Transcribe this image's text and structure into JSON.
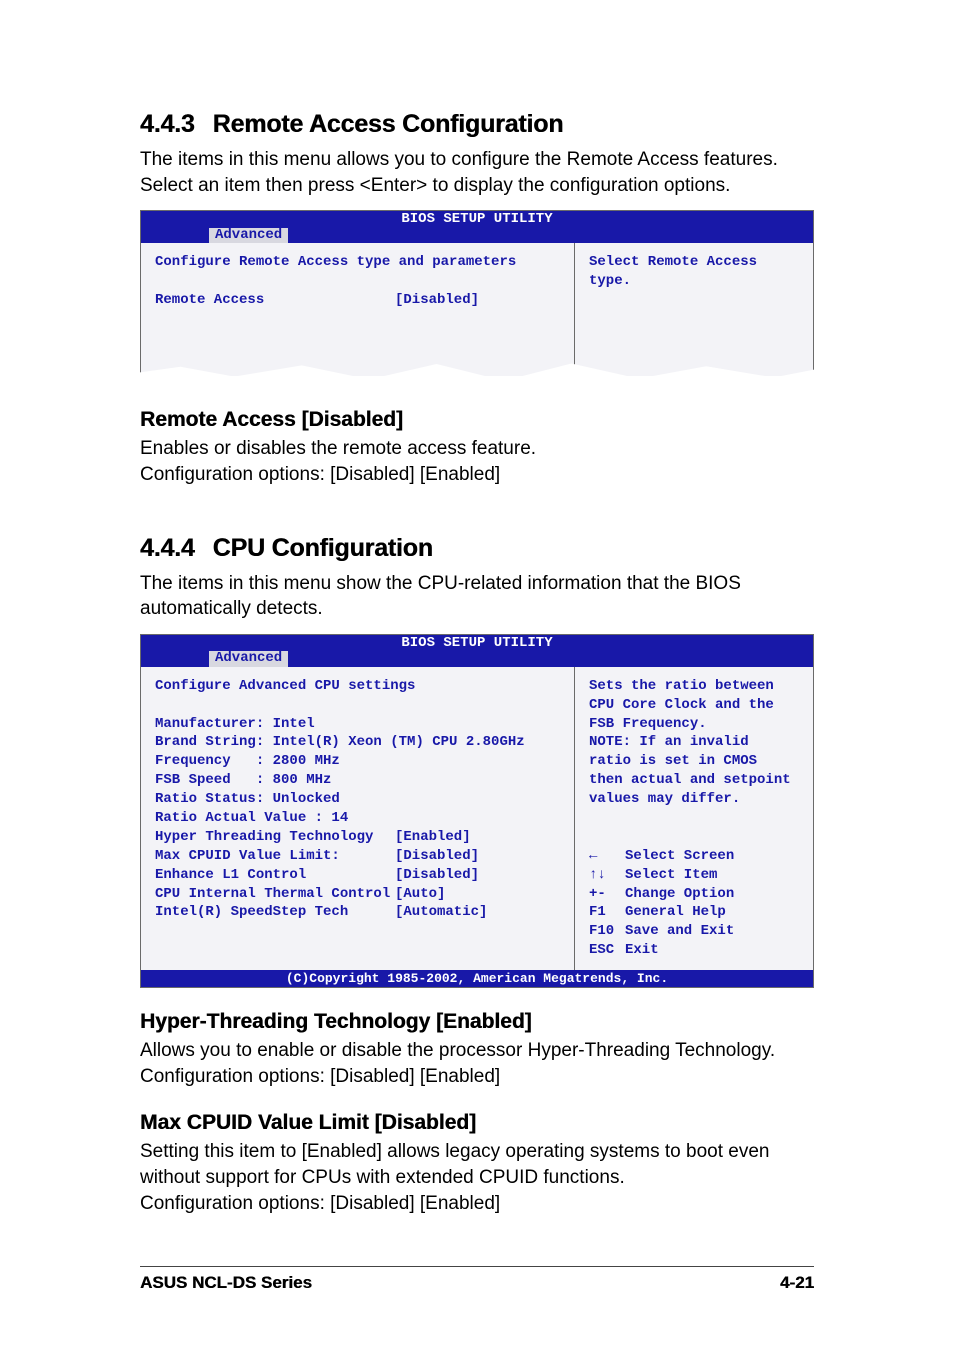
{
  "section443": {
    "number": "4.4.3",
    "title": "Remote Access Configuration",
    "intro": "The items in this menu allows you to configure the Remote Access features. Select an item then press <Enter> to display the configuration options."
  },
  "bios_ra": {
    "title": "BIOS SETUP UTILITY",
    "tab": "Advanced",
    "heading": "Configure Remote Access type and parameters",
    "item_label": "Remote Access",
    "item_value": "[Disabled]",
    "help": "Select Remote Access type."
  },
  "remote_access": {
    "heading": "Remote Access [Disabled]",
    "desc1": "Enables or disables the remote access feature.",
    "desc2": "Configuration options: [Disabled] [Enabled]"
  },
  "section444": {
    "number": "4.4.4",
    "title": "CPU Configuration",
    "intro": "The items in this menu show the CPU-related information that the BIOS automatically detects."
  },
  "bios_cpu": {
    "title": "BIOS SETUP UTILITY",
    "tab": "Advanced",
    "heading": "Configure Advanced CPU settings",
    "manufacturer": "Manufacturer: Intel",
    "brand": "Brand String: Intel(R) Xeon (TM) CPU 2.80GHz",
    "frequency": "Frequency   : 2800 MHz",
    "fsb": "FSB Speed   : 800 MHz",
    "ratio_status": "Ratio Status: Unlocked",
    "ratio_actual": "Ratio Actual Value : 14",
    "rows": [
      {
        "label": "Hyper Threading Technology",
        "value": "[Enabled]"
      },
      {
        "label": "Max CPUID Value Limit:",
        "value": "[Disabled]"
      },
      {
        "label": "Enhance L1 Control",
        "value": "[Disabled]"
      },
      {
        "label": "CPU Internal Thermal Control",
        "value": "[Auto]"
      },
      {
        "label": "Intel(R) SpeedStep Tech",
        "value": "[Automatic]"
      }
    ],
    "help": "Sets the ratio between CPU Core Clock and the FSB Frequency.\nNOTE: If an invalid ratio is set in CMOS then actual and setpoint values may differ.",
    "keys": [
      {
        "k": "←",
        "d": "Select Screen"
      },
      {
        "k": "↑↓",
        "d": "Select Item"
      },
      {
        "k": "+-",
        "d": "Change Option"
      },
      {
        "k": "F1",
        "d": "General Help"
      },
      {
        "k": "F10",
        "d": "Save and Exit"
      },
      {
        "k": "ESC",
        "d": "Exit"
      }
    ],
    "copyright": "(C)Copyright 1985-2002, American Megatrends, Inc."
  },
  "hyper_threading": {
    "heading": "Hyper-Threading Technology [Enabled]",
    "desc1": "Allows you to enable or disable the processor Hyper-Threading Technology.",
    "desc2": "Configuration options: [Disabled] [Enabled]"
  },
  "max_cpuid": {
    "heading": "Max CPUID Value Limit [Disabled]",
    "desc1": "Setting this item to [Enabled] allows legacy operating systems to boot even without support for CPUs with extended CPUID functions.",
    "desc2": "Configuration options: [Disabled] [Enabled]"
  },
  "footer": {
    "left": "ASUS NCL-DS Series",
    "right": "4-21"
  }
}
